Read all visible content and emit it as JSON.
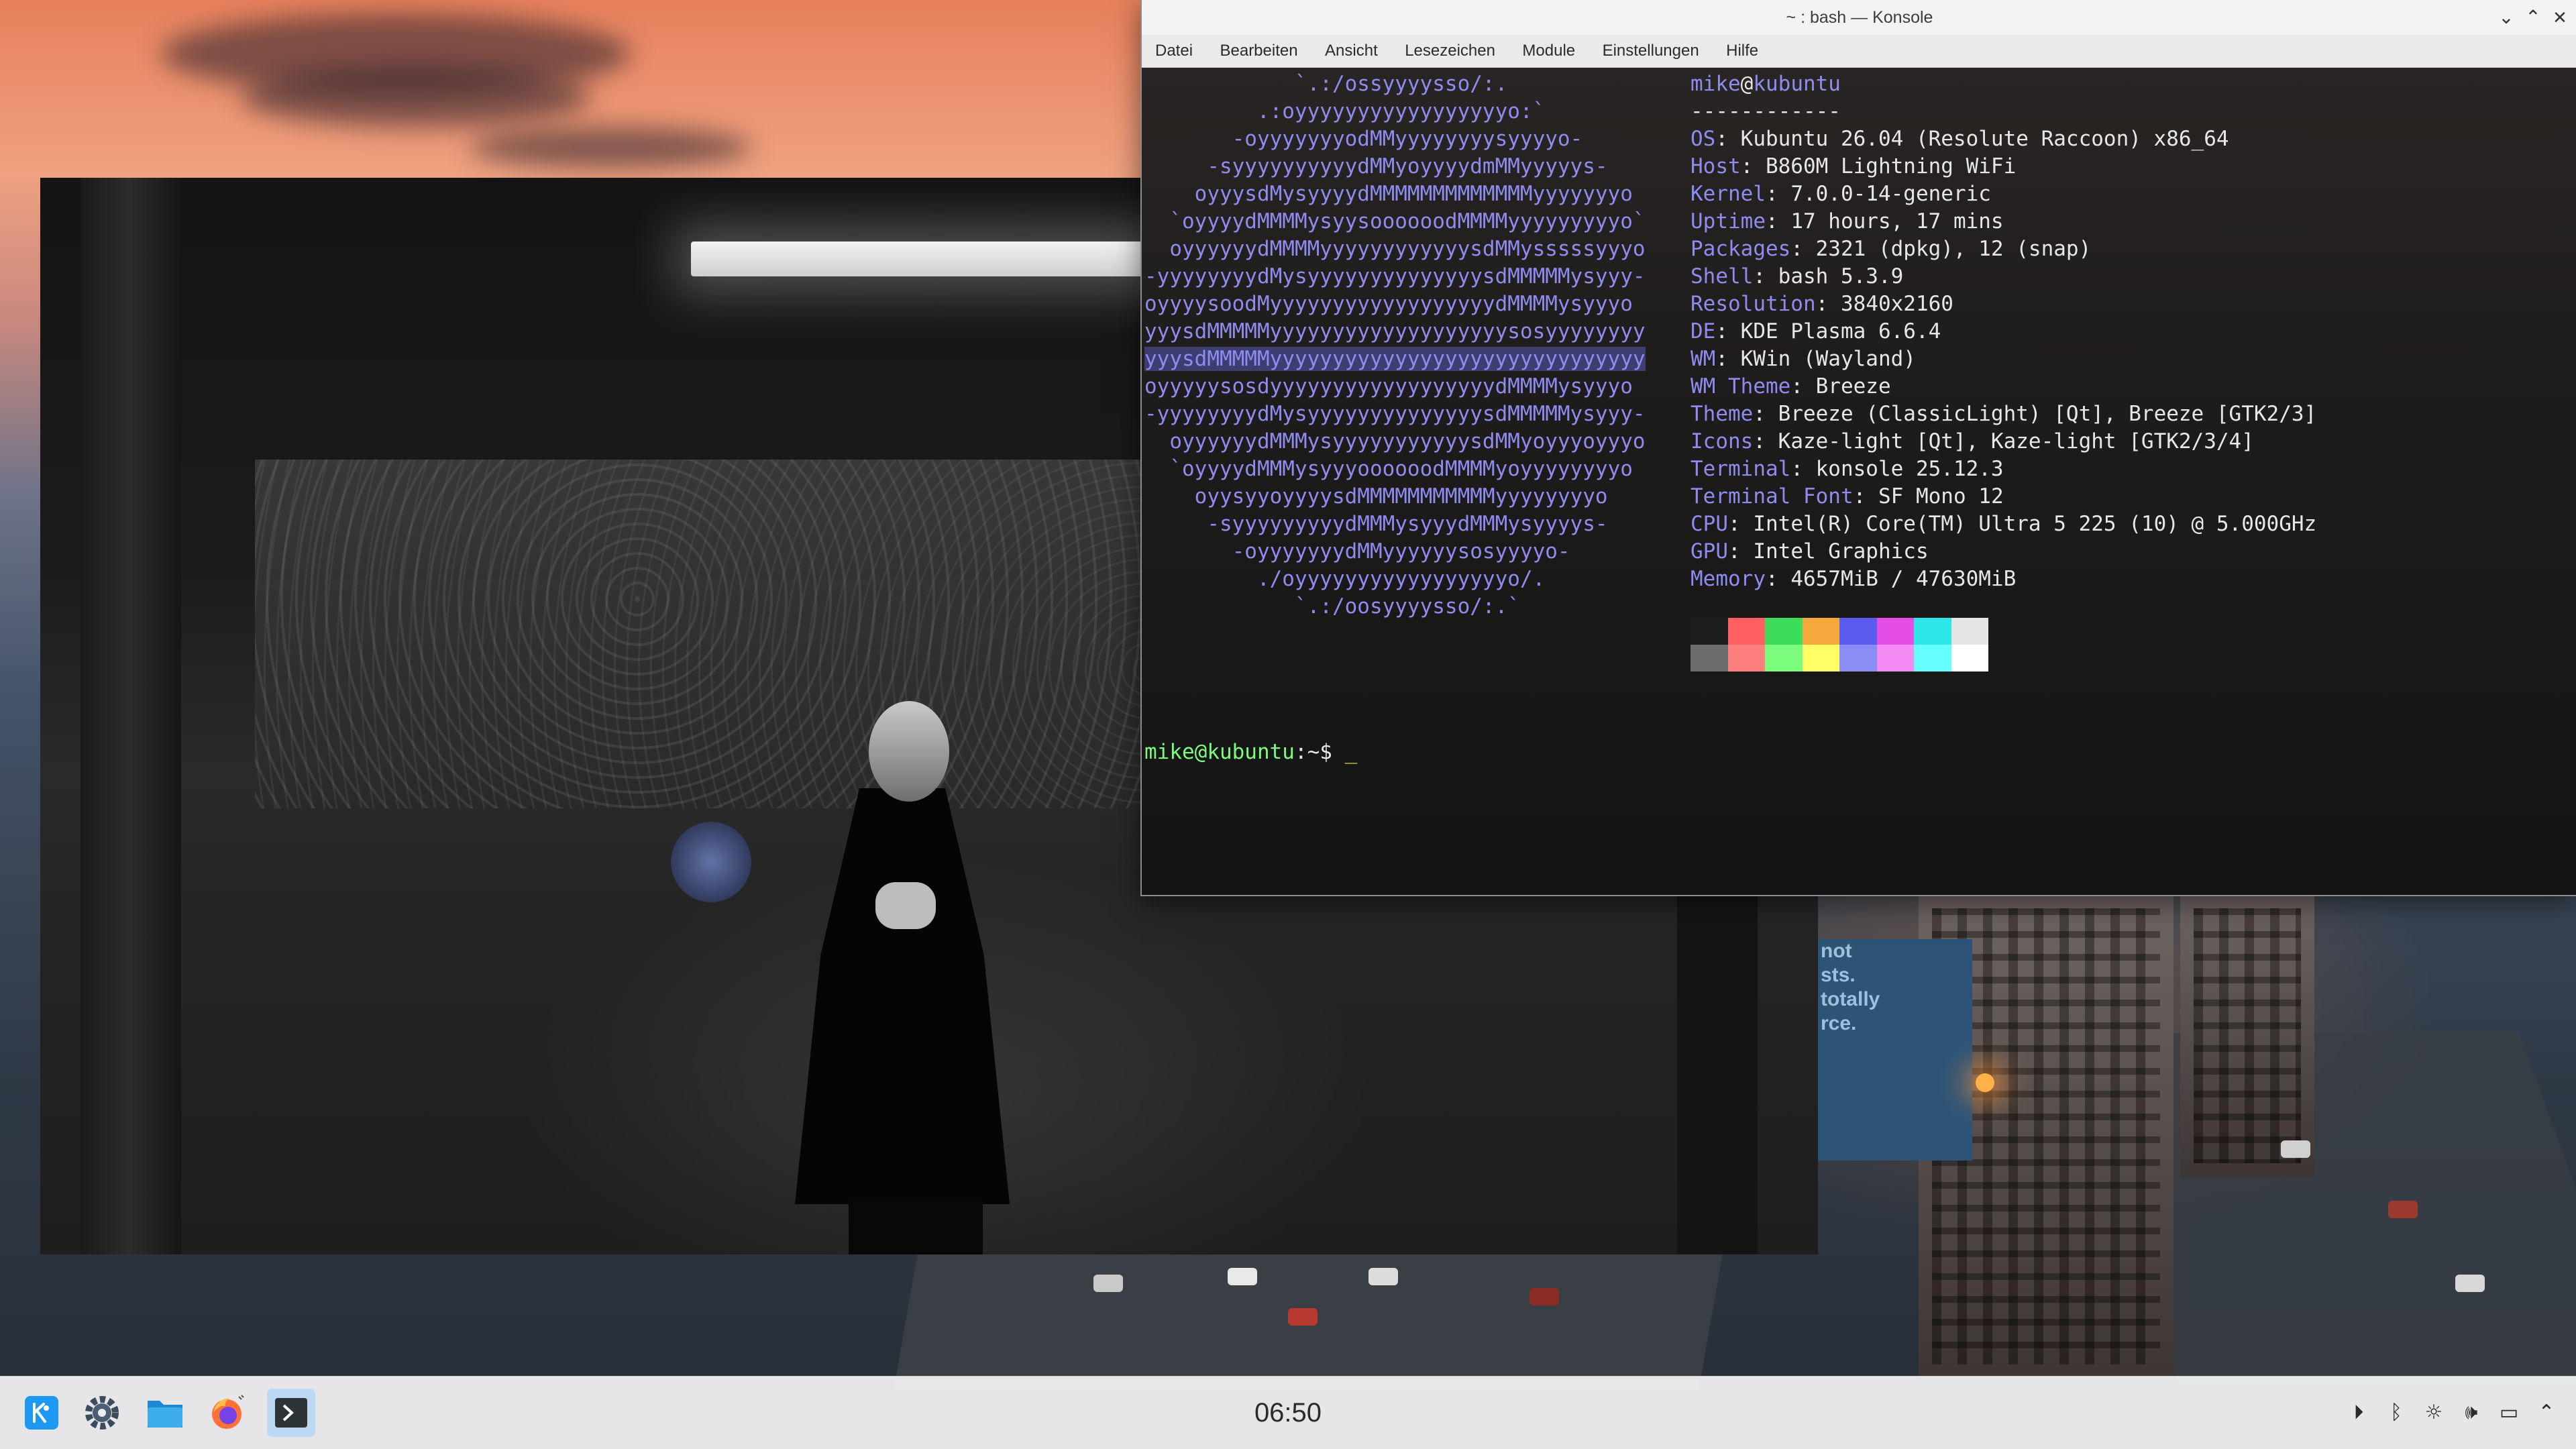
{
  "konsole": {
    "title": "~ : bash — Konsole",
    "menu": [
      "Datei",
      "Bearbeiten",
      "Ansicht",
      "Lesezeichen",
      "Module",
      "Einstellungen",
      "Hilfe"
    ],
    "ascii_art": [
      "            `.:/ossyyyysso/:.",
      "         .:oyyyyyyyyyyyyyyyyyo:`",
      "       -oyyyyyyyodMMyyyyyyyysyyyyo-",
      "     -syyyyyyyyyydMMyoyyyydmMMyyyyys-",
      "    oyyysdMysyyyydMMMMMMMMMMMMMyyyyyyyo",
      "  `oyyyydMMMMysyysoooooodMMMMyyyyyyyyyo`",
      "  oyyyyyydMMMMyyyyyyyyyyyysdMMysssssyyyo",
      "-yyyyyyyydMysyyyyyyyyyyyyyysdMMMMMysyyy-",
      "oyyyysoodMyyyyyyyyyyyyyyyyyydMMMMysyyyo",
      "yyysdMMMMMyyyyyyyyyyyyyyyyyyysosyyyyyyyy",
      "yyysdMMMMMyyyyyyyyyyyyyyyyyyyyyyyyyyyyyy",
      "oyyyyysosdyyyyyyyyyyyyyyyyyydMMMMysyyyo",
      "-yyyyyyyydMysyyyyyyyyyyyyyysdMMMMMysyyy-",
      "  oyyyyyydMMMysyyyyyyyyyyysdMMyoyyyoyyyo",
      "  `oyyyydMMMysyyyoooooodMMMMyoyyyyyyyyo",
      "    oyysyyoyyyysdMMMMMMMMMMMyyyyyyyyo",
      "     -syyyyyyyyydMMMysyyydMMMysyyyys-",
      "       -oyyyyyyydMMyyyyyysosyyyyo-",
      "         ./oyyyyyyyyyyyyyyyyyo/.",
      "            `.:/oosyyyysso/:.`"
    ],
    "user": "mike",
    "host": "kubuntu",
    "separator": "------------",
    "info": [
      {
        "key": "OS",
        "value": "Kubuntu 26.04 (Resolute Raccoon) x86_64"
      },
      {
        "key": "Host",
        "value": "B860M Lightning WiFi"
      },
      {
        "key": "Kernel",
        "value": "7.0.0-14-generic"
      },
      {
        "key": "Uptime",
        "value": "17 hours, 17 mins"
      },
      {
        "key": "Packages",
        "value": "2321 (dpkg), 12 (snap)"
      },
      {
        "key": "Shell",
        "value": "bash 5.3.9"
      },
      {
        "key": "Resolution",
        "value": "3840x2160"
      },
      {
        "key": "DE",
        "value": "KDE Plasma 6.6.4"
      },
      {
        "key": "WM",
        "value": "KWin (Wayland)"
      },
      {
        "key": "WM Theme",
        "value": "Breeze"
      },
      {
        "key": "Theme",
        "value": "Breeze (ClassicLight) [Qt], Breeze [GTK2/3]"
      },
      {
        "key": "Icons",
        "value": "Kaze-light [Qt], Kaze-light [GTK2/3/4]"
      },
      {
        "key": "Terminal",
        "value": "konsole 25.12.3"
      },
      {
        "key": "Terminal Font",
        "value": "SF Mono 12"
      },
      {
        "key": "CPU",
        "value": "Intel(R) Core(TM) Ultra 5 225 (10) @ 5.000GHz"
      },
      {
        "key": "GPU",
        "value": "Intel Graphics"
      },
      {
        "key": "Memory",
        "value": "4657MiB / 47630MiB"
      }
    ],
    "palette_top": [
      "#1e1e1e",
      "#ff5f5f",
      "#3ddc5a",
      "#f6a93b",
      "#5b5bf0",
      "#e54ee5",
      "#2ee8e8",
      "#e6e6e6"
    ],
    "palette_bottom": [
      "#6c6c6c",
      "#ff7f7f",
      "#7cfc7c",
      "#ffff66",
      "#8c8cf5",
      "#f58cf5",
      "#66ffff",
      "#ffffff"
    ],
    "prompt": "mike@kubuntu",
    "prompt_suffix": ":~$ ",
    "cursor": "_"
  },
  "desktop": {
    "billboard_lines": [
      "not",
      "sts.",
      "totally",
      "rce."
    ]
  },
  "taskbar": {
    "apps": [
      "kde-launcher-icon",
      "system-settings-icon",
      "file-manager-icon",
      "firefox-icon",
      "konsole-icon"
    ],
    "clock": "06:50",
    "tray": [
      "media-play-icon",
      "bluetooth-icon",
      "brightness-icon",
      "volume-icon",
      "network-icon",
      "chevron-up-icon"
    ]
  }
}
